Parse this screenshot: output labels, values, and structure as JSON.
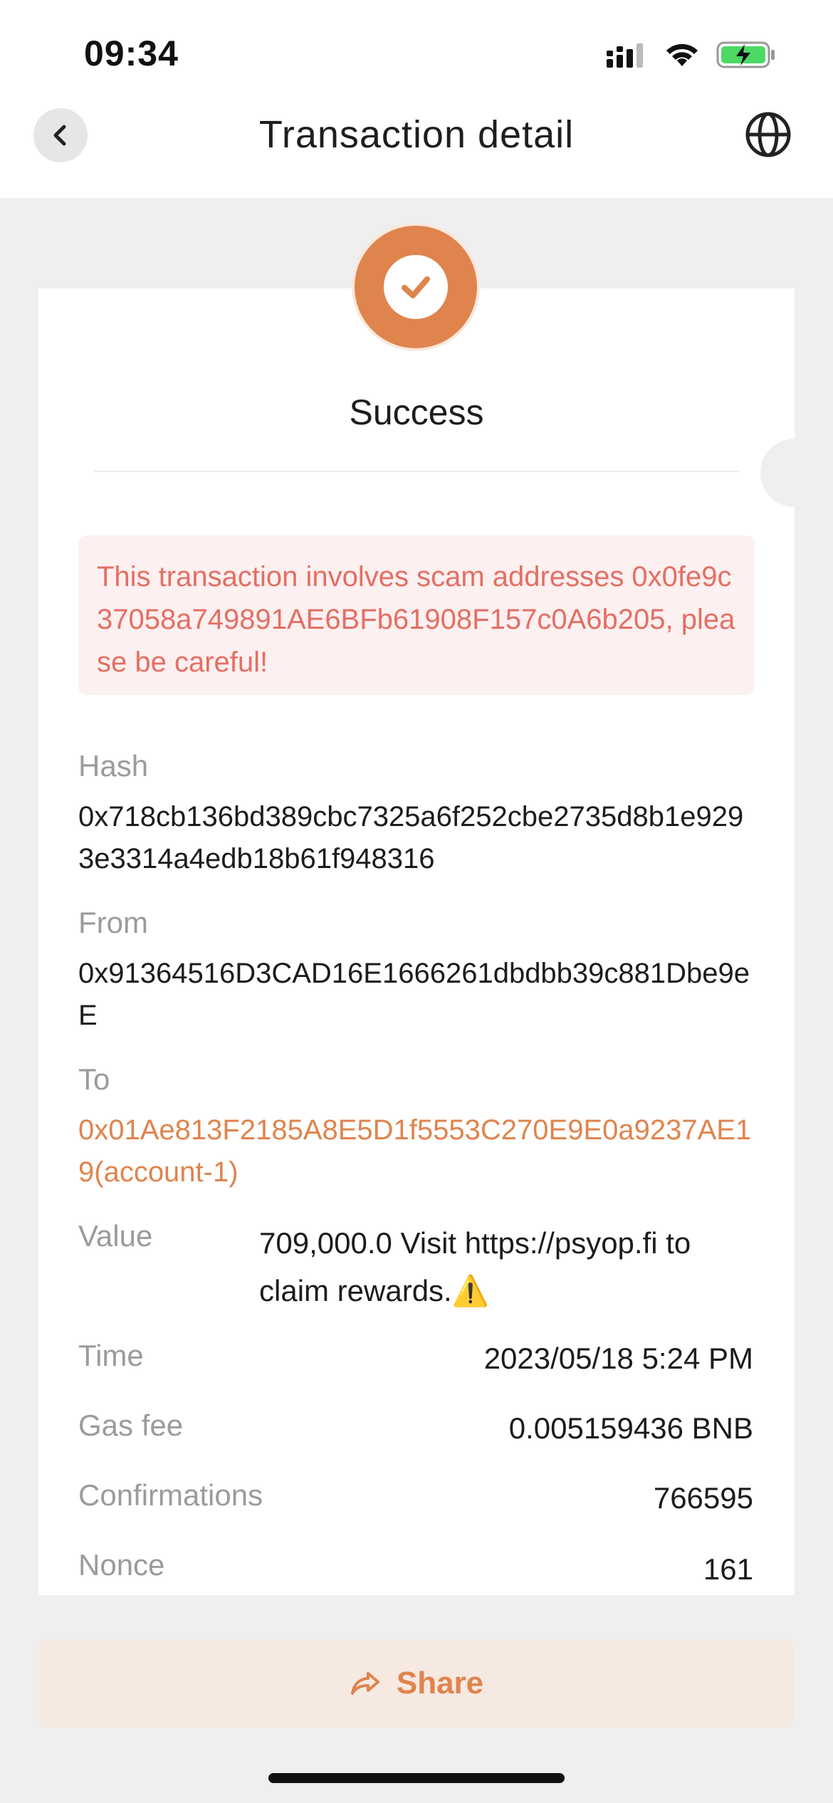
{
  "status_bar": {
    "time": "09:34"
  },
  "nav": {
    "title": "Transaction detail"
  },
  "status": {
    "label": "Success"
  },
  "warning": {
    "text": "This transaction involves scam addresses 0x0fe9c37058a749891AE6BFb61908F157c0A6b205, please be careful!"
  },
  "details": {
    "hash_label": "Hash",
    "hash": "0x718cb136bd389cbc7325a6f252cbe2735d8b1e9293e3314a4edb18b61f948316",
    "from_label": "From",
    "from": "0x91364516D3CAD16E1666261dbdbb39c881Dbe9eE",
    "to_label": "To",
    "to": "0x01Ae813F2185A8E5D1f5553C270E9E0a9237AE19(account-1)",
    "value_label": "Value",
    "value": "709,000.0 Visit https://psyop.fi to claim rewards.⚠️",
    "time_label": "Time",
    "time": "2023/05/18 5:24 PM",
    "gas_label": "Gas fee",
    "gas": "0.005159436 BNB",
    "confirmations_label": "Confirmations",
    "confirmations": "766595",
    "nonce_label": "Nonce",
    "nonce": "161"
  },
  "share": {
    "label": "Share"
  },
  "colors": {
    "accent": "#df844d",
    "warning_text": "#e46e63",
    "warning_bg": "#fdf0f0",
    "success_green": "#4cd964"
  },
  "icons": [
    "signal-icon",
    "wifi-icon",
    "battery-charging-icon",
    "back-chevron-icon",
    "globe-icon",
    "checkmark-icon",
    "share-arrow-icon"
  ]
}
